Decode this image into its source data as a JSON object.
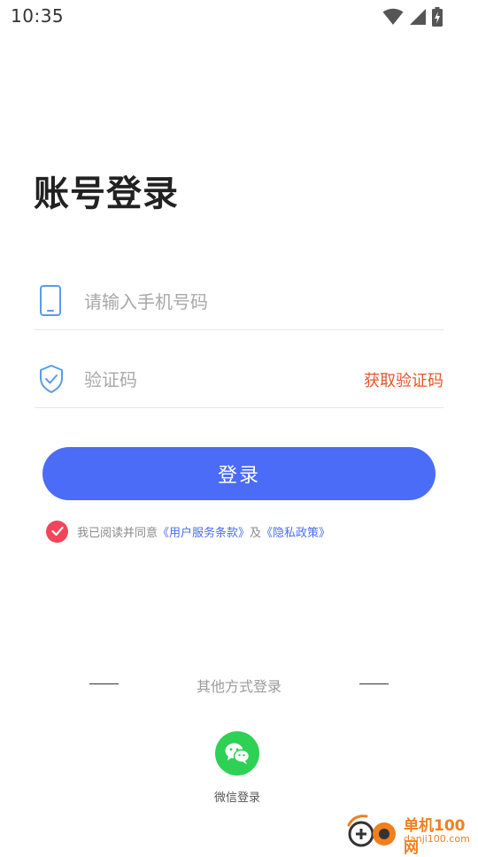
{
  "status_bar": {
    "time": "10:35",
    "icons": [
      "wifi-icon",
      "signal-icon",
      "battery-charging-icon"
    ]
  },
  "login": {
    "title": "账号登录",
    "phone_placeholder": "请输入手机号码",
    "phone_value": "",
    "code_placeholder": "验证码",
    "code_value": "",
    "get_code_label": "获取验证码",
    "submit_label": "登录"
  },
  "agreement": {
    "checked": true,
    "prefix": "我已阅读并同意",
    "terms_link": "《用户服务条款》",
    "conjunction": "及",
    "privacy_link": "《隐私政策》"
  },
  "other_login": {
    "label": "其他方式登录",
    "wechat_label": "微信登录"
  },
  "watermark": {
    "name": "单机100网",
    "domain": "danji100.com"
  },
  "colors": {
    "primary": "#4a6cf7",
    "accent_orange": "#e9562b",
    "check_red": "#f0455a",
    "wechat_green": "#2ed154",
    "icon_blue": "#5b9be8"
  }
}
